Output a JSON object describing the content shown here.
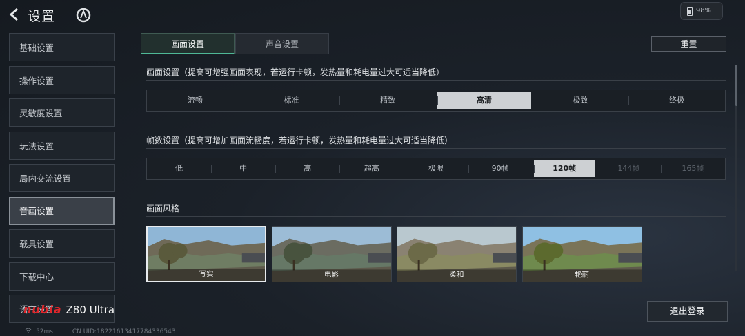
{
  "header": {
    "title": "设置",
    "battery": "98%"
  },
  "sidebar": {
    "items": [
      {
        "label": "基础设置"
      },
      {
        "label": "操作设置"
      },
      {
        "label": "灵敏度设置"
      },
      {
        "label": "玩法设置"
      },
      {
        "label": "局内交流设置"
      },
      {
        "label": "音画设置"
      },
      {
        "label": "载具设置"
      },
      {
        "label": "下载中心"
      },
      {
        "label": "语言设置"
      }
    ],
    "active_index": 5
  },
  "tabs": [
    {
      "label": "画面设置"
    },
    {
      "label": "声音设置"
    }
  ],
  "active_tab": 0,
  "reset_label": "重置",
  "graphics": {
    "label": "画面设置（提高可增强画面表现，若运行卡顿，发热量和耗电量过大可适当降低）",
    "options": [
      "流畅",
      "标准",
      "精致",
      "高清",
      "极致",
      "终极"
    ],
    "selected": "高清"
  },
  "fps": {
    "label": "帧数设置（提高可增加画面流畅度，若运行卡顿，发热量和耗电量过大可适当降低）",
    "options": [
      "低",
      "中",
      "高",
      "超高",
      "极限",
      "90帧",
      "120帧",
      "144帧",
      "165帧"
    ],
    "selected": "120帧",
    "disabled": [
      "144帧",
      "165帧"
    ]
  },
  "style": {
    "label": "画面风格",
    "options": [
      "写实",
      "电影",
      "柔和",
      "艳丽"
    ],
    "selected": "写实"
  },
  "logout_label": "退出登录",
  "watermark": {
    "brand": "nubia",
    "model": "Z80 Ultra"
  },
  "footer": {
    "ping": "52ms",
    "uid": "CN UID:1822161341778433654З"
  }
}
